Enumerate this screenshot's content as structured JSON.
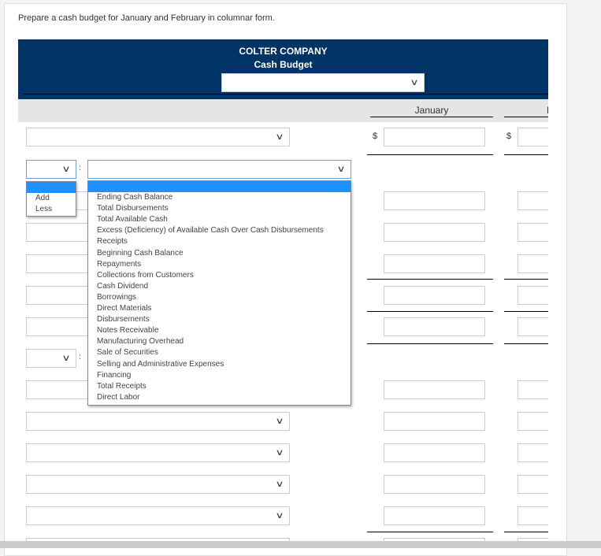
{
  "instruction": "Prepare a cash budget for January and February in columnar form.",
  "header": {
    "company": "COLTER COMPANY",
    "title": "Cash Budget",
    "period_select": ""
  },
  "columns": {
    "january": "January",
    "february": "February"
  },
  "currency": "$",
  "addless_options": [
    "",
    "Add",
    "Less"
  ],
  "item_options": [
    "",
    "Ending Cash Balance",
    "Total Disbursements",
    "Total Available Cash",
    "Excess (Deficiency) of Available Cash Over Cash Disbursements",
    "Receipts",
    "Beginning Cash Balance",
    "Repayments",
    "Collections from Customers",
    "Cash Dividend",
    "Borrowings",
    "Direct Materials",
    "Disbursements",
    "Notes Receivable",
    "Manufacturing Overhead",
    "Sale of Securities",
    "Selling and Administrative Expenses",
    "Financing",
    "Total Receipts",
    "Direct Labor"
  ],
  "colon": ":"
}
